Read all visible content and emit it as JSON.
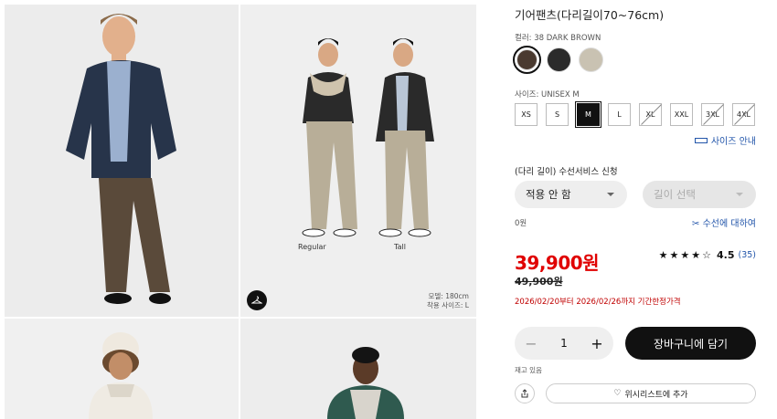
{
  "product": {
    "title": "기어팬츠(다리길이70~76cm)",
    "color_label": "컬러: 38 DARK BROWN",
    "colors": [
      "#4a3a30",
      "#2b2b2b",
      "#c9c2b2"
    ],
    "size_label": "사이즈: UNISEX M",
    "sizes": [
      "XS",
      "S",
      "M",
      "L",
      "XL",
      "XXL",
      "3XL",
      "4XL"
    ],
    "size_guide": "사이즈 안내",
    "hem_label": "(다리 길이) 수선서비스 신청",
    "hem_option": "적용 안 함",
    "length_select": "길이 선택",
    "hem_price": "0원",
    "hem_about": "수선에 대하여",
    "price": "39,900원",
    "original_price": "49,900원",
    "rating_score": "4.5",
    "rating_count": "(35)",
    "promo": "2026/02/20부터 2026/02/26까지 기간한정가격",
    "quantity": "1",
    "minus": "−",
    "plus": "+",
    "add_to_cart": "장바구니에 담기",
    "stock": "재고 있음",
    "wishlist": "위시리스트에 추가"
  },
  "gallery": {
    "caption_regular": "Regular",
    "caption_tall": "Tall",
    "model_height": "모델: 180cm",
    "model_size": "착용 사이즈: L"
  }
}
